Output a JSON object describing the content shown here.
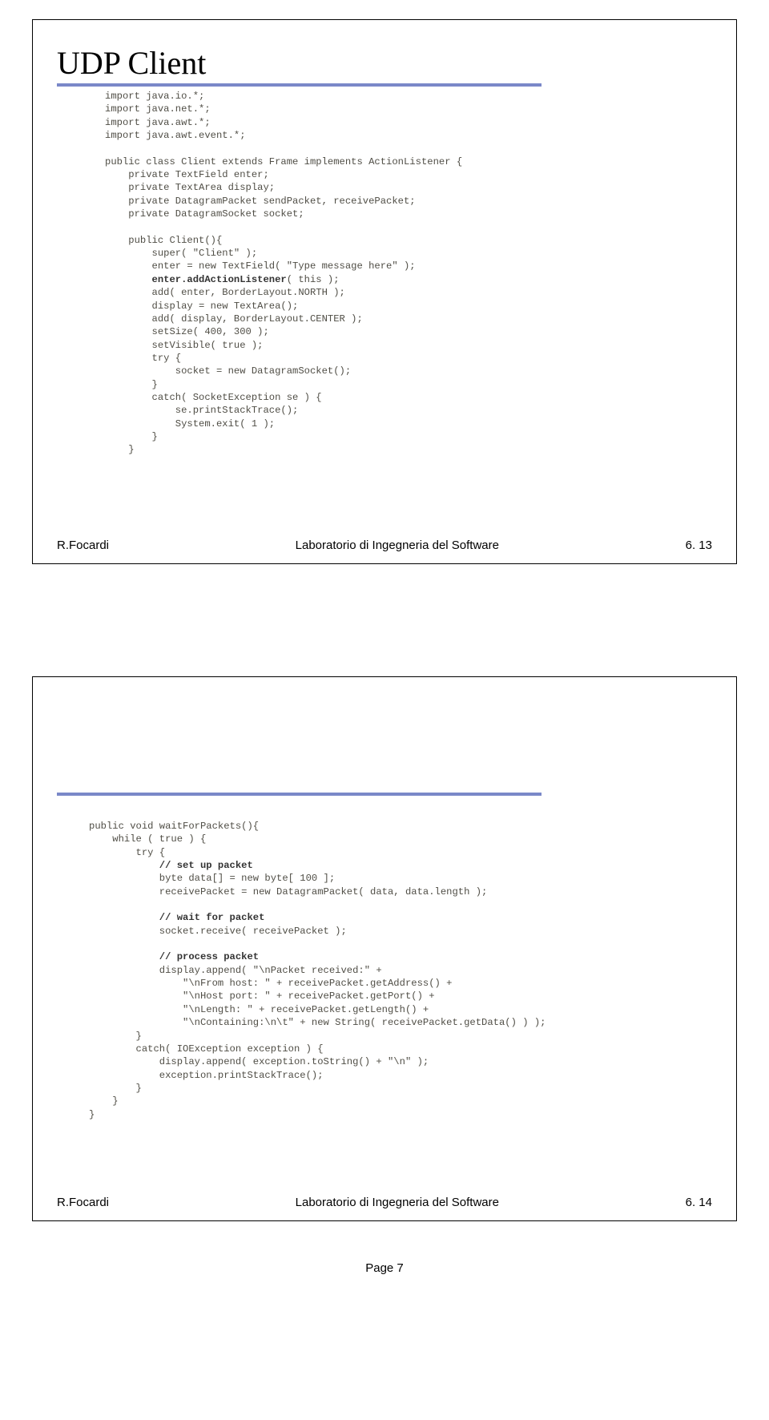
{
  "slide1": {
    "title": "UDP Client",
    "code": {
      "l01": "import java.io.*;",
      "l02": "import java.net.*;",
      "l03": "import java.awt.*;",
      "l04": "import java.awt.event.*;",
      "l05": "",
      "l06": "public class Client extends Frame implements ActionListener {",
      "l07": "    private TextField enter;",
      "l08": "    private TextArea display;",
      "l09": "    private DatagramPacket sendPacket, receivePacket;",
      "l10": "    private DatagramSocket socket;",
      "l11": "",
      "l12": "    public Client(){",
      "l13": "        super( \"Client\" );",
      "l14": "        enter = new TextField( \"Type message here\" );",
      "l15a": "        ",
      "l15b": "enter.addActionListener",
      "l15c": "( this );",
      "l16": "        add( enter, BorderLayout.NORTH );",
      "l17": "        display = new TextArea();",
      "l18": "        add( display, BorderLayout.CENTER );",
      "l19": "        setSize( 400, 300 );",
      "l20": "        setVisible( true );",
      "l21": "        try {",
      "l22": "            socket = new DatagramSocket();",
      "l23": "        }",
      "l24": "        catch( SocketException se ) {",
      "l25": "            se.printStackTrace();",
      "l26": "            System.exit( 1 );",
      "l27": "        }",
      "l28": "    }"
    },
    "footer_left": "R.Focardi",
    "footer_center": "Laboratorio di Ingegneria del Software",
    "footer_right": "6. 13"
  },
  "slide2": {
    "code": {
      "l01": "public void waitForPackets(){",
      "l02": "    while ( true ) {",
      "l03": "        try {",
      "l04a": "            ",
      "l04b": "// set up packet",
      "l05": "            byte data[] = new byte[ 100 ];",
      "l06": "            receivePacket = new DatagramPacket( data, data.length );",
      "l07": "",
      "l08a": "            ",
      "l08b": "// wait for packet",
      "l09": "            socket.receive( receivePacket );",
      "l10": "",
      "l11a": "            ",
      "l11b": "// process packet",
      "l12": "            display.append( \"\\nPacket received:\" +",
      "l13": "                \"\\nFrom host: \" + receivePacket.getAddress() +",
      "l14": "                \"\\nHost port: \" + receivePacket.getPort() +",
      "l15": "                \"\\nLength: \" + receivePacket.getLength() +",
      "l16": "                \"\\nContaining:\\n\\t\" + new String( receivePacket.getData() ) );",
      "l17": "        }",
      "l18": "        catch( IOException exception ) {",
      "l19": "            display.append( exception.toString() + \"\\n\" );",
      "l20": "            exception.printStackTrace();",
      "l21": "        }",
      "l22": "    }",
      "l23": "}"
    },
    "footer_left": "R.Focardi",
    "footer_center": "Laboratorio di Ingegneria del Software",
    "footer_right": "6. 14"
  },
  "page_number": "Page 7"
}
